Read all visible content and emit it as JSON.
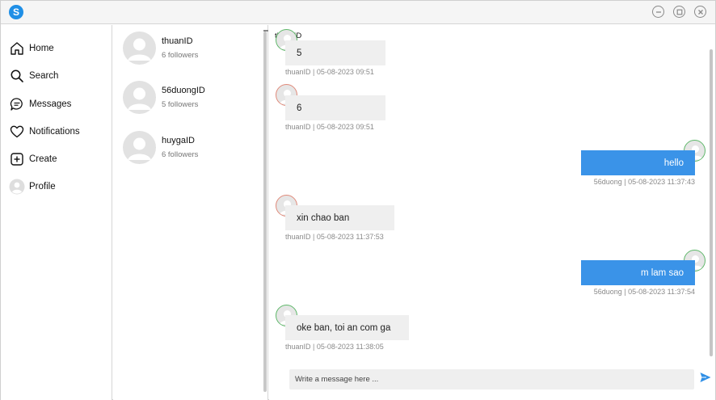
{
  "app": {
    "logo_letter": "S",
    "window_controls": [
      "minimize-icon",
      "maximize-icon",
      "close-icon"
    ]
  },
  "sidebar": {
    "items": [
      {
        "label": "Home",
        "icon": "home-icon"
      },
      {
        "label": "Search",
        "icon": "search-icon"
      },
      {
        "label": "Messages",
        "icon": "messages-icon"
      },
      {
        "label": "Notifications",
        "icon": "heart-icon"
      },
      {
        "label": "Create",
        "icon": "plus-square-icon"
      },
      {
        "label": "Profile",
        "icon": "avatar-icon"
      }
    ]
  },
  "users": [
    {
      "name": "thuanID",
      "followers": "6 followers"
    },
    {
      "name": "56duongID",
      "followers": "5 followers"
    },
    {
      "name": "huygaID",
      "followers": "6 followers"
    }
  ],
  "chat": {
    "header": "thuanID",
    "messages": [
      {
        "direction": "in",
        "text": "5",
        "meta": "thuanID | 05-08-2023 09:51"
      },
      {
        "direction": "in",
        "text": "6",
        "meta": "thuanID | 05-08-2023 09:51"
      },
      {
        "direction": "out",
        "text": "hello",
        "meta": "56duong | 05-08-2023 11:37:43"
      },
      {
        "direction": "in",
        "text": "xin chao ban",
        "meta": "thuanID | 05-08-2023 11:37:53"
      },
      {
        "direction": "out",
        "text": "m lam sao",
        "meta": "56duong | 05-08-2023 11:37:54"
      },
      {
        "direction": "in",
        "text": "oke ban, toi an com ga",
        "meta": "thuanID | 05-08-2023 11:38:05"
      }
    ],
    "composer_placeholder": "Write a message here ...",
    "colors": {
      "outgoing": "#3a93e8",
      "incoming": "#efefef",
      "avatar_in_ring": "#e08a7a",
      "avatar_out_ring": "#5fb86a",
      "logo": "#1f8fe6"
    }
  }
}
